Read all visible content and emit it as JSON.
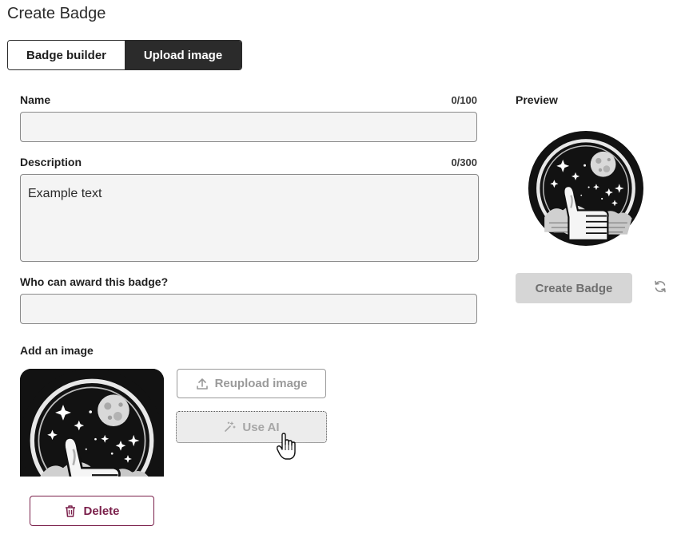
{
  "page": {
    "title": "Create Badge"
  },
  "tabs": [
    {
      "label": "Badge builder",
      "active": false
    },
    {
      "label": "Upload image",
      "active": true
    }
  ],
  "form": {
    "name": {
      "label": "Name",
      "counter": "0/100",
      "value": "",
      "placeholder": ""
    },
    "description": {
      "label": "Description",
      "counter": "0/300",
      "value": "Example text"
    },
    "awarders": {
      "label": "Who can award this badge?",
      "value": ""
    },
    "image": {
      "label": "Add an image"
    }
  },
  "buttons": {
    "reupload": "Reupload image",
    "use_ai": "Use AI",
    "delete": "Delete",
    "create": "Create Badge"
  },
  "preview": {
    "label": "Preview"
  },
  "icons": {
    "reupload": "upload-icon",
    "use_ai": "sparkle-wand-icon",
    "delete": "trash-icon",
    "refresh": "refresh-icon",
    "cursor": "hand-pointer-icon"
  },
  "colors": {
    "tab_active_bg": "#2b2b2b",
    "delete_accent": "#7a1f4a",
    "field_bg": "#f4f4f4",
    "disabled_button_bg": "#d6d6d6"
  }
}
